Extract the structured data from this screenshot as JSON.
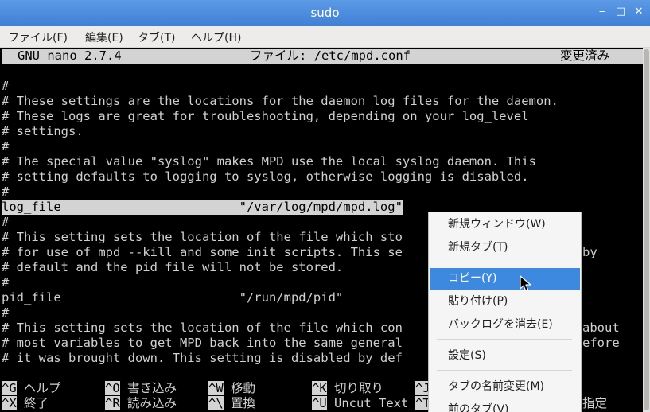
{
  "window": {
    "title": "sudo",
    "minimize": "‒",
    "maximize": "□",
    "close": "✕"
  },
  "menubar": {
    "file": "ファイル(F)",
    "edit": "編集(E)",
    "tabs": "タブ(T)",
    "help": "ヘルプ(H)"
  },
  "nano": {
    "version": "GNU nano 2.7.4",
    "file_label": "ファイル: /etc/mpd.conf",
    "status": "変更済み"
  },
  "editor_lines": [
    "#",
    "# These settings are the locations for the daemon log files for the daemon.",
    "# These logs are great for troubleshooting, depending on your log_level",
    "# settings.",
    "#",
    "# The special value \"syslog\" makes MPD use the local syslog daemon. This",
    "# setting defaults to logging to syslog, otherwise logging is disabled.",
    "#",
    "log_file                        \"/var/log/mpd/mpd.log\"",
    "#",
    "# This setting sets the location of the file which sto",
    "# for use of mpd --kill and some init scripts. This se",
    "# default and the pid file will not be stored.",
    "#",
    "pid_file                        \"/run/mpd/pid\"",
    "#",
    "# This setting sets the location of the file which con",
    "# most variables to get MPD back into the same general",
    "# it was brought down. This setting is disabled by def"
  ],
  "right_fragments": {
    "line_pid_by": "by",
    "line_state_about": "about",
    "line_state_before": "efore"
  },
  "shortcuts": {
    "row1": [
      {
        "key": "^G",
        "label": "ヘルプ"
      },
      {
        "key": "^O",
        "label": "書き込み"
      },
      {
        "key": "^W",
        "label": "移動"
      },
      {
        "key": "^K",
        "label": "切り取り"
      },
      {
        "key": "^J",
        "label": ""
      }
    ],
    "row2": [
      {
        "key": "^X",
        "label": "終了"
      },
      {
        "key": "^R",
        "label": "読み込み"
      },
      {
        "key": "^\\",
        "label": "置換"
      },
      {
        "key": "^U",
        "label": "Uncut Text"
      },
      {
        "key": "^T",
        "label": ""
      }
    ],
    "row2_tail": "指定"
  },
  "context_menu": {
    "items": [
      {
        "label": "新規ウィンドウ(W)"
      },
      {
        "label": "新規タブ(T)"
      },
      {
        "label": "コピー(Y)",
        "selected": true
      },
      {
        "label": "貼り付け(P)"
      },
      {
        "label": "バックログを消去(E)"
      },
      {
        "label": "設定(S)"
      },
      {
        "label": "タブの名前変更(M)"
      },
      {
        "label": "前のタブ(V)"
      }
    ]
  },
  "colors": {
    "titlebar": "#4a8ad9",
    "terminal_bg": "#000000",
    "terminal_fg": "#d0d0d0",
    "highlight": "#d3d3d3",
    "menu_selection": "#3d89e0"
  }
}
